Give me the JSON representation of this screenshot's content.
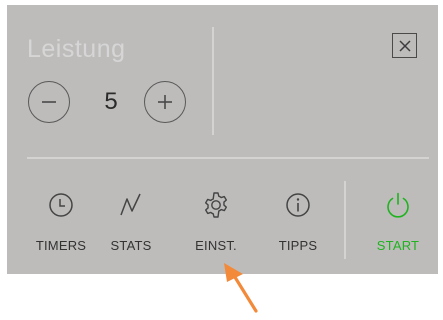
{
  "title": "Leistung",
  "stepper": {
    "value": "5",
    "minus_icon": "minus-circle-icon",
    "plus_icon": "plus-circle-icon"
  },
  "close_icon": "close-icon",
  "nav": [
    {
      "key": "timers",
      "label": "TIMERS",
      "icon": "clock-icon"
    },
    {
      "key": "stats",
      "label": "STATS",
      "icon": "chart-line-icon"
    },
    {
      "key": "settings",
      "label": "EINST.",
      "icon": "gear-icon"
    },
    {
      "key": "tips",
      "label": "TIPPS",
      "icon": "info-icon"
    },
    {
      "key": "start",
      "label": "START",
      "icon": "power-icon"
    }
  ],
  "colors": {
    "panel": "#bdbcbb",
    "accent_green": "#1fb31f",
    "arrow_orange": "#f28a3a"
  }
}
